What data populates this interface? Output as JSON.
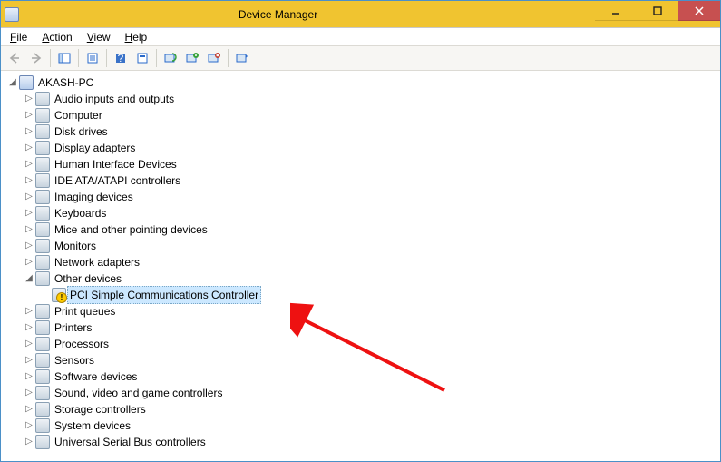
{
  "window": {
    "title": "Device Manager"
  },
  "menu": {
    "file": "File",
    "action": "Action",
    "view": "View",
    "help": "Help"
  },
  "tree": {
    "root": "AKASH-PC",
    "categories": [
      {
        "name": "Audio inputs and outputs",
        "expanded": false
      },
      {
        "name": "Computer",
        "expanded": false
      },
      {
        "name": "Disk drives",
        "expanded": false
      },
      {
        "name": "Display adapters",
        "expanded": false
      },
      {
        "name": "Human Interface Devices",
        "expanded": false
      },
      {
        "name": "IDE ATA/ATAPI controllers",
        "expanded": false
      },
      {
        "name": "Imaging devices",
        "expanded": false
      },
      {
        "name": "Keyboards",
        "expanded": false
      },
      {
        "name": "Mice and other pointing devices",
        "expanded": false
      },
      {
        "name": "Monitors",
        "expanded": false
      },
      {
        "name": "Network adapters",
        "expanded": false
      },
      {
        "name": "Other devices",
        "expanded": true,
        "children": [
          {
            "name": "PCI Simple Communications Controller",
            "warning": true,
            "selected": true
          }
        ]
      },
      {
        "name": "Print queues",
        "expanded": false
      },
      {
        "name": "Printers",
        "expanded": false
      },
      {
        "name": "Processors",
        "expanded": false
      },
      {
        "name": "Sensors",
        "expanded": false
      },
      {
        "name": "Software devices",
        "expanded": false
      },
      {
        "name": "Sound, video and game controllers",
        "expanded": false
      },
      {
        "name": "Storage controllers",
        "expanded": false
      },
      {
        "name": "System devices",
        "expanded": false
      },
      {
        "name": "Universal Serial Bus controllers",
        "expanded": false
      }
    ]
  }
}
